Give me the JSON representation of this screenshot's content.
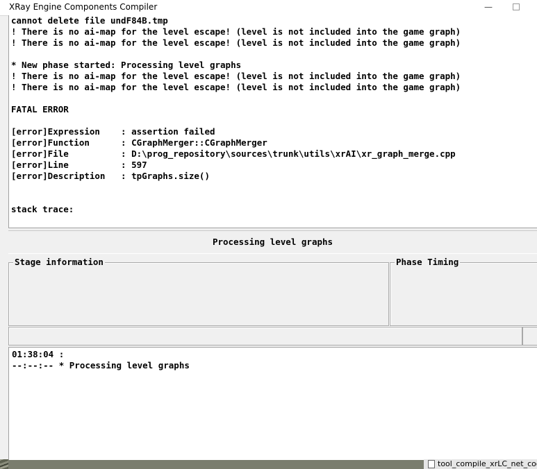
{
  "window": {
    "title": "XRay Engine Components Compiler",
    "minimize_symbol": "—"
  },
  "log": {
    "lines": [
      "cannot delete file undF84B.tmp",
      "! There is no ai-map for the level escape! (level is not included into the game graph)",
      "! There is no ai-map for the level escape! (level is not included into the game graph)",
      "",
      "* New phase started: Processing level graphs",
      "! There is no ai-map for the level escape! (level is not included into the game graph)",
      "! There is no ai-map for the level escape! (level is not included into the game graph)",
      "",
      "FATAL ERROR",
      "",
      "[error]Expression    : assertion failed",
      "[error]Function      : CGraphMerger::CGraphMerger",
      "[error]File          : D:\\prog_repository\\sources\\trunk\\utils\\xrAI\\xr_graph_merge.cpp",
      "[error]Line          : 597",
      "[error]Description   : tpGraphs.size()",
      "",
      "",
      "stack trace:"
    ]
  },
  "phase": {
    "name": "Processing level graphs"
  },
  "groups": {
    "stage_label": "Stage information",
    "timing_label": "Phase Timing"
  },
  "status": {
    "lines": [
      "01:38:04 :",
      "--:--:-- * Processing level graphs"
    ]
  },
  "taskbar": {
    "item_label": "tool_compile_xrLC_net_coo"
  }
}
